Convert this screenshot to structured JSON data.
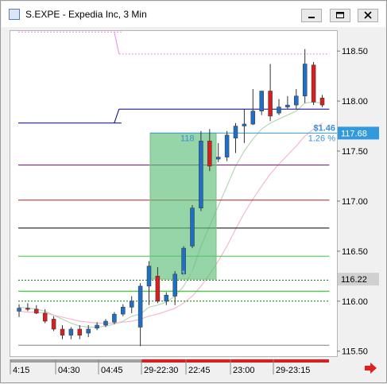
{
  "window": {
    "title": "S.EXPE - Expedia Inc, 3 Min",
    "icon": "chart-app-icon",
    "controls": [
      "minimize-icon",
      "restore-icon",
      "close-icon"
    ]
  },
  "chart_data": {
    "type": "candlestick",
    "symbol": "S.EXPE",
    "interval": "3 Min",
    "y_range": [
      115.45,
      118.7
    ],
    "y_ticks": [
      "118.50",
      "118.00",
      "117.50",
      "117.00",
      "116.50",
      "116.00",
      "115.50"
    ],
    "x_ticks": [
      "4:15",
      "04:30",
      "04:45",
      "29-22:30",
      "22:45",
      "23:00",
      "29-23:15"
    ],
    "last_price_tag": "116.22",
    "reference_price_tag": "117.68",
    "reference_price": 117.68,
    "last_price": 116.22,
    "position_box": {
      "entry": 116.22,
      "exit": 117.68,
      "entry_label": "116",
      "exit_label": "118",
      "profit_label": "$1.46",
      "percent_label": "1.26 %"
    },
    "candles": [
      {
        "o": 115.9,
        "h": 115.97,
        "l": 115.84,
        "c": 115.93
      },
      {
        "o": 115.93,
        "h": 115.98,
        "l": 115.9,
        "c": 115.92
      },
      {
        "o": 115.92,
        "h": 115.96,
        "l": 115.87,
        "c": 115.88
      },
      {
        "o": 115.88,
        "h": 115.92,
        "l": 115.78,
        "c": 115.8
      },
      {
        "o": 115.82,
        "h": 115.85,
        "l": 115.7,
        "c": 115.72
      },
      {
        "o": 115.72,
        "h": 115.76,
        "l": 115.62,
        "c": 115.66
      },
      {
        "o": 115.66,
        "h": 115.74,
        "l": 115.62,
        "c": 115.72
      },
      {
        "o": 115.72,
        "h": 115.76,
        "l": 115.62,
        "c": 115.66
      },
      {
        "o": 115.68,
        "h": 115.76,
        "l": 115.64,
        "c": 115.72
      },
      {
        "o": 115.73,
        "h": 115.79,
        "l": 115.71,
        "c": 115.76
      },
      {
        "o": 115.76,
        "h": 115.82,
        "l": 115.74,
        "c": 115.8
      },
      {
        "o": 115.79,
        "h": 115.89,
        "l": 115.77,
        "c": 115.87
      },
      {
        "o": 115.87,
        "h": 115.97,
        "l": 115.85,
        "c": 115.94
      },
      {
        "o": 115.94,
        "h": 116.05,
        "l": 115.88,
        "c": 116.0
      },
      {
        "o": 115.74,
        "h": 116.18,
        "l": 115.55,
        "c": 116.15
      },
      {
        "o": 116.15,
        "h": 116.4,
        "l": 115.96,
        "c": 116.35
      },
      {
        "o": 116.25,
        "h": 116.34,
        "l": 115.98,
        "c": 116.0
      },
      {
        "o": 116.0,
        "h": 116.09,
        "l": 115.96,
        "c": 116.06
      },
      {
        "o": 116.05,
        "h": 116.3,
        "l": 115.96,
        "c": 116.27
      },
      {
        "o": 116.27,
        "h": 116.55,
        "l": 116.25,
        "c": 116.53
      },
      {
        "o": 116.55,
        "h": 116.96,
        "l": 116.53,
        "c": 116.93
      },
      {
        "o": 116.93,
        "h": 117.7,
        "l": 116.9,
        "c": 117.6
      },
      {
        "o": 117.6,
        "h": 117.72,
        "l": 117.3,
        "c": 117.35
      },
      {
        "o": 117.42,
        "h": 117.58,
        "l": 117.39,
        "c": 117.44
      },
      {
        "o": 117.44,
        "h": 117.7,
        "l": 117.4,
        "c": 117.66
      },
      {
        "o": 117.63,
        "h": 117.78,
        "l": 117.48,
        "c": 117.75
      },
      {
        "o": 117.75,
        "h": 117.92,
        "l": 117.58,
        "c": 117.77
      },
      {
        "o": 117.77,
        "h": 118.12,
        "l": 117.76,
        "c": 117.9
      },
      {
        "o": 117.9,
        "h": 118.03,
        "l": 117.86,
        "c": 118.1
      },
      {
        "o": 118.1,
        "h": 118.37,
        "l": 117.8,
        "c": 117.85
      },
      {
        "o": 117.88,
        "h": 118.02,
        "l": 117.86,
        "c": 117.94
      },
      {
        "o": 117.94,
        "h": 118.05,
        "l": 117.92,
        "c": 117.96
      },
      {
        "o": 117.96,
        "h": 118.12,
        "l": 117.92,
        "c": 118.05
      },
      {
        "o": 118.05,
        "h": 118.52,
        "l": 117.98,
        "c": 118.37
      },
      {
        "o": 118.36,
        "h": 118.39,
        "l": 117.96,
        "c": 117.99
      },
      {
        "o": 118.03,
        "h": 118.06,
        "l": 117.94,
        "c": 117.96
      }
    ],
    "horizontal_levels": [
      {
        "color": "#ee82ee",
        "dashed": true,
        "segments": [
          [
            0,
            12,
            118.69
          ],
          [
            12,
            36,
            118.47
          ]
        ]
      },
      {
        "color": "#00008b",
        "dashed": false,
        "segments": [
          [
            0,
            12,
            117.78
          ],
          [
            12,
            36,
            117.92
          ]
        ]
      },
      {
        "color": "#800080",
        "dashed": false,
        "segments": [
          [
            0,
            36,
            117.36
          ]
        ]
      },
      {
        "color": "#b22222",
        "dashed": false,
        "segments": [
          [
            0,
            36,
            117.01
          ]
        ]
      },
      {
        "color": "#000000",
        "dashed": false,
        "segments": [
          [
            0,
            36,
            116.73
          ]
        ]
      },
      {
        "color": "#32cd32",
        "dashed": false,
        "segments": [
          [
            0,
            36,
            116.45
          ]
        ]
      },
      {
        "color": "#008000",
        "dashed": true,
        "segments": [
          [
            0,
            36,
            116.21
          ]
        ]
      },
      {
        "color": "#00cc00",
        "dashed": false,
        "segments": [
          [
            0,
            36,
            116.1
          ]
        ]
      },
      {
        "color": "#008000",
        "dashed": true,
        "segments": [
          [
            0,
            36,
            116.0
          ]
        ]
      },
      {
        "color": "#808080",
        "dashed": false,
        "segments": [
          [
            0,
            36,
            115.56
          ]
        ]
      }
    ],
    "moving_averages": [
      {
        "color": "#b7d8b7",
        "values": [
          115.94,
          115.93,
          115.92,
          115.9,
          115.86,
          115.82,
          115.78,
          115.75,
          115.74,
          115.74,
          115.75,
          115.77,
          115.8,
          115.85,
          115.87,
          115.94,
          115.96,
          115.99,
          116.05,
          116.15,
          116.3,
          116.55,
          116.75,
          116.95,
          117.15,
          117.35,
          117.5,
          117.62,
          117.72,
          117.78,
          117.82,
          117.86,
          117.9,
          117.98,
          117.99,
          117.98
        ]
      },
      {
        "color": "#f5b8cf",
        "values": [
          115.9,
          115.89,
          115.89,
          115.88,
          115.86,
          115.84,
          115.82,
          115.8,
          115.79,
          115.78,
          115.78,
          115.78,
          115.79,
          115.8,
          115.82,
          115.85,
          115.87,
          115.9,
          115.93,
          115.98,
          116.05,
          116.15,
          116.27,
          116.4,
          116.55,
          116.72,
          116.88,
          117.02,
          117.15,
          117.27,
          117.37,
          117.46,
          117.55,
          117.65,
          117.72,
          117.78
        ]
      }
    ]
  }
}
